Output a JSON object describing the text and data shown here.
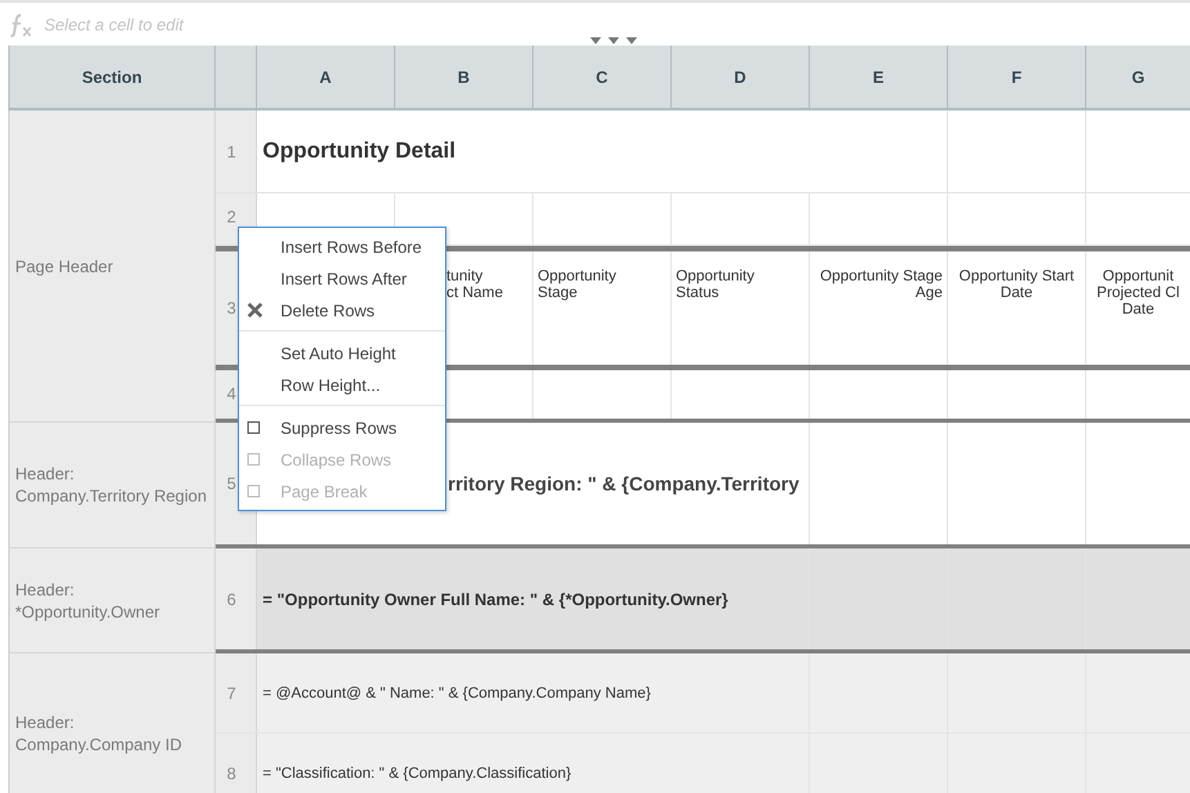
{
  "formula_bar": {
    "placeholder": "Select a cell to edit"
  },
  "grid": {
    "section_heading": "Section",
    "columns": [
      "A",
      "B",
      "C",
      "D",
      "E",
      "F",
      "G"
    ],
    "sections": [
      {
        "label": "Page Header",
        "rows": [
          {
            "number": "1",
            "kind": "title",
            "text": "Opportunity Detail"
          },
          {
            "number": "2",
            "kind": "blank"
          },
          {
            "number": "3",
            "kind": "labels",
            "cells": [
              {
                "text": "tunity\nct Name"
              },
              {
                "text": "Opportunity Stage"
              },
              {
                "text": "Opportunity Status"
              },
              {
                "text": "Opportunity Stage Age"
              },
              {
                "text": "Opportunity Start Date"
              },
              {
                "text": "Opportunit\nProjected Cl\nDate"
              }
            ]
          },
          {
            "number": "4",
            "kind": "blank"
          }
        ]
      },
      {
        "label": "Header: Company.Territory Region",
        "rows": [
          {
            "number": "5",
            "kind": "group",
            "text": "rritory Region: \" & {Company.Territory"
          }
        ]
      },
      {
        "label": "Header: *Opportunity.Owner",
        "rows": [
          {
            "number": "6",
            "kind": "owner",
            "text": "= \"Opportunity Owner Full Name: \" & {*Opportunity.Owner}"
          }
        ]
      },
      {
        "label": "Header: Company.Company ID",
        "rows": [
          {
            "number": "7",
            "kind": "detail",
            "text": "= @Account@ & \" Name: \" & {Company.Company Name}"
          },
          {
            "number": "8",
            "kind": "detail",
            "text": "= \"Classification: \" & {Company.Classification}"
          }
        ]
      }
    ]
  },
  "context_menu": {
    "groups": [
      [
        {
          "label": "Insert Rows Before",
          "kind": "plain"
        },
        {
          "label": "Insert Rows After",
          "kind": "plain"
        },
        {
          "label": "Delete Rows",
          "kind": "delete"
        }
      ],
      [
        {
          "label": "Set Auto Height",
          "kind": "plain"
        },
        {
          "label": "Row Height...",
          "kind": "plain"
        }
      ],
      [
        {
          "label": "Suppress Rows",
          "kind": "check",
          "checked": false,
          "disabled": false
        },
        {
          "label": "Collapse Rows",
          "kind": "check",
          "checked": false,
          "disabled": true
        },
        {
          "label": "Page Break",
          "kind": "check",
          "checked": false,
          "disabled": true
        }
      ]
    ]
  }
}
